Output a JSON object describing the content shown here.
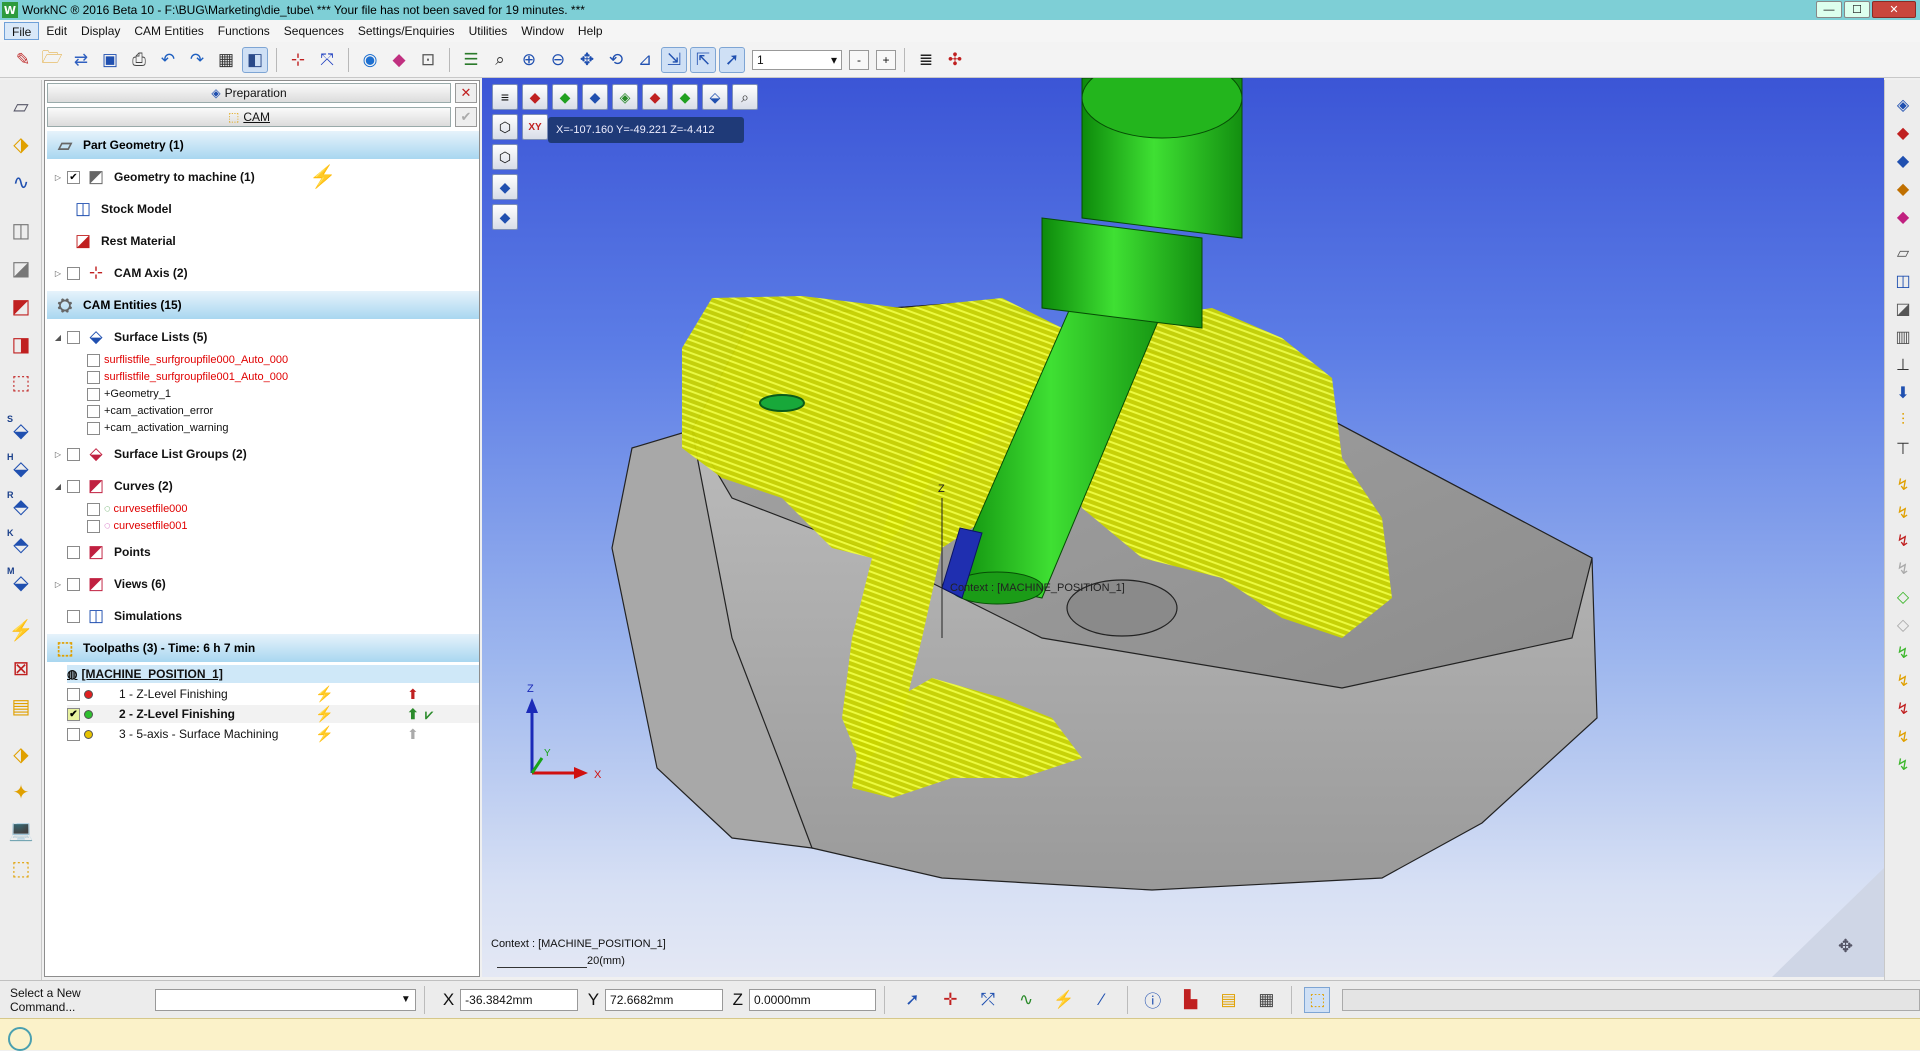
{
  "window": {
    "title": "WorkNC ® 2016 Beta 10 - F:\\BUG\\Marketing\\die_tube\\ *** Your file has not been saved for 19 minutes. ***",
    "logo_letter": "W",
    "min_icon": "—",
    "max_icon": "☐",
    "close_icon": "✕"
  },
  "menu": [
    "File",
    "Edit",
    "Display",
    "CAM Entities",
    "Functions",
    "Sequences",
    "Settings/Enquiries",
    "Utilities",
    "Window",
    "Help"
  ],
  "toolbar": {
    "zoom_value": "1",
    "dropdown_arrow": "▾",
    "minus_label": "-",
    "plus_label": "+"
  },
  "panel": {
    "preparation_tab": "Preparation",
    "cam_tab": "CAM",
    "close_glyph": "✕",
    "check_glyph": "✔",
    "sections": {
      "part_geometry": "Part Geometry (1)",
      "cam_entities": "CAM Entities (15)",
      "toolpaths": "Toolpaths (3) - Time: 6 h 7 min"
    },
    "part_geometry_items": {
      "geometry": "Geometry to machine (1)",
      "stock": "Stock Model",
      "rest": "Rest Material",
      "cam_axis": "CAM Axis (2)"
    },
    "cam_items": {
      "surface_lists": "Surface Lists (5)",
      "sl1": "surflistfile_surfgroupfile000_Auto_000",
      "sl2": "surflistfile_surfgroupfile001_Auto_000",
      "sl3": "+Geometry_1",
      "sl4": "+cam_activation_error",
      "sl5": "+cam_activation_warning",
      "surface_list_groups": "Surface List Groups (2)",
      "curves": "Curves (2)",
      "c1": "curvesetfile000",
      "c2": "curvesetfile001",
      "points": "Points",
      "views": "Views (6)",
      "simulations": "Simulations"
    },
    "machine_position": "[MACHINE_POSITION_1]",
    "toolpaths": [
      {
        "label": "1 - Z-Level Finishing",
        "checked": false,
        "status": "#e02020"
      },
      {
        "label": "2 - Z-Level Finishing",
        "checked": true,
        "status": "#2fbf2f"
      },
      {
        "label": "3 - 5-axis - Surface Machining",
        "checked": false,
        "status": "#e6c200"
      }
    ],
    "checked_mark": "✔"
  },
  "viewport": {
    "coords": "X=-107.160  Y=-49.221  Z=-4.412",
    "context_label": "Context : [MACHINE_POSITION_1]",
    "context_inline": "Context : [MACHINE_POSITION_1]",
    "scale_label": "20(mm)",
    "triad_x": "X",
    "triad_y": "Y",
    "triad_z": "Z",
    "part_z": "Z"
  },
  "bottombar": {
    "command_label": "Select a New Command...",
    "command_value": "",
    "x_label": "X",
    "x_value": "-36.3842mm",
    "y_label": "Y",
    "y_value": "72.6682mm",
    "z_label": "Z",
    "z_value": "0.0000mm"
  },
  "colors": {
    "titlebar": "#7ecfd6",
    "section_header": "#a9d7f0",
    "toolpath_yellow": "#e8f200",
    "tool_green": "#22c21c",
    "part_gray": "#9a9a9a",
    "viewport_top": "#3b55d6"
  }
}
